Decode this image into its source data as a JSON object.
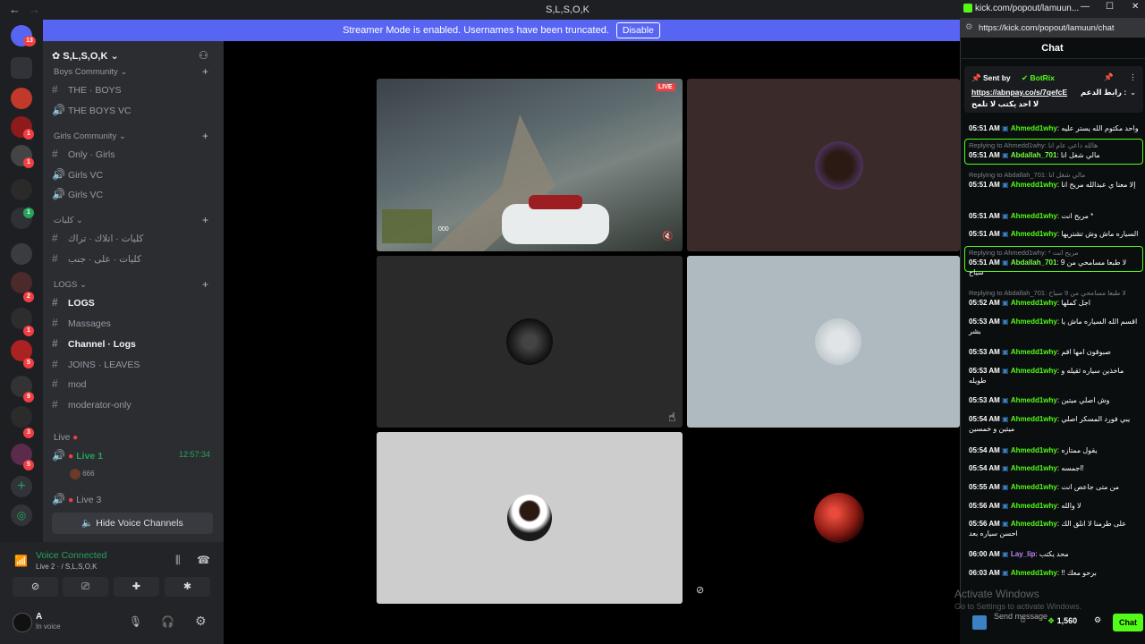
{
  "discord": {
    "window_title": "S,L,S,O,K",
    "banner": {
      "text": "Streamer Mode is enabled. Usernames have been truncated.",
      "button": "Disable"
    },
    "server_name": "S,L,S,O,K",
    "rail_badges": [
      "13",
      "1",
      "1",
      "1",
      "2",
      "1",
      "5",
      "9",
      "3",
      "5"
    ],
    "categories": [
      {
        "label": "Boys Community"
      },
      {
        "label": "Girls Community"
      },
      {
        "label": "كليات"
      },
      {
        "label": "LOGS"
      },
      {
        "label": "Live"
      }
    ],
    "channels": [
      {
        "label": "THE · BOYS"
      },
      {
        "label": "THE BOYS VC"
      },
      {
        "label": "Only · Girls"
      },
      {
        "label": "Girls VC"
      },
      {
        "label": "Girls VC"
      },
      {
        "label": "كليات · اتلاك · تراك"
      },
      {
        "label": "كليات · على · جنب"
      },
      {
        "label": "LOGS"
      },
      {
        "label": "Massages"
      },
      {
        "label": "Channel · Logs"
      },
      {
        "label": "JOINS · LEAVES"
      },
      {
        "label": "mod"
      },
      {
        "label": "moderator-only"
      }
    ],
    "live_channels": [
      {
        "label": "Live 1",
        "timer": "12:57:34"
      },
      {
        "label": "Live 3"
      }
    ],
    "live_member": "666",
    "hide_voice": "Hide Voice Channels",
    "voice": {
      "status": "Voice Connected",
      "sub": "Live 2 · / S,L,S,O,K"
    },
    "user": {
      "name": "A",
      "status": "In voice"
    },
    "live_badge": "LIVE",
    "hud_number": "000"
  },
  "kick": {
    "tab_title": "kick.com/popout/lamuun...",
    "url": "https://kick.com/popout/lamuun/chat",
    "header": "Chat",
    "pinned": {
      "label": "Sent by",
      "user": "BotRix",
      "link": "https://abnpay.co/s/7qefcE",
      "text": "رابط الدعم :",
      "text2": "لا احد يكتب لا تلمح"
    },
    "messages": [
      {
        "time": "05:51 AM",
        "user": "Ahmedd1why",
        "text": "واحد مكتوم الله يستر عليه"
      },
      {
        "reply": "Replying to Ahmedd1why: هالله داعي عام انا",
        "time": "05:51 AM",
        "user": "Abdallah_701",
        "text": "مالي شغل انا",
        "highlight": true
      },
      {
        "reply": "Replying to Abdallah_701: مالي شغل انا",
        "time": "05:51 AM",
        "user": "Ahmedd1why",
        "text": "إلا معنا ي عبدالله مريح انا"
      },
      {
        "time": "05:51 AM",
        "user": "Ahmedd1why",
        "text": "مريح انت *"
      },
      {
        "time": "05:51 AM",
        "user": "Ahmedd1why",
        "text": "السياره ماش وش تشتريها"
      },
      {
        "reply": "Replying to Ahmedd1why: * مريح انت",
        "time": "05:51 AM",
        "user": "Abdallah_701",
        "text": "لا طبعا مسامحي من 9 سياح",
        "highlight": true
      },
      {
        "reply": "Replying to Abdallah_701: لا طبعا مسامحي من 9 سياح",
        "time": "05:52 AM",
        "user": "Ahmedd1why",
        "text": "اجل كملها"
      },
      {
        "time": "05:53 AM",
        "user": "Ahmedd1why",
        "text": "اقسم الله السياره ماش يا بشر"
      },
      {
        "time": "05:53 AM",
        "user": "Ahmedd1why",
        "text": "صبوقون امها اقم"
      },
      {
        "time": "05:53 AM",
        "user": "Ahmedd1why",
        "text": "ماخذين سياره ثقيله و طويله"
      },
      {
        "time": "05:53 AM",
        "user": "Ahmedd1why",
        "text": "وش اصلي ميتين"
      },
      {
        "time": "05:54 AM",
        "user": "Ahmedd1why",
        "text": "يبي فورد المسكر اصلي ميتين و خمسين"
      },
      {
        "time": "05:54 AM",
        "user": "Ahmedd1why",
        "text": "يقول ممتازه"
      },
      {
        "time": "05:54 AM",
        "user": "Ahmedd1why",
        "text": "اجمسه!"
      },
      {
        "time": "05:55 AM",
        "user": "Ahmedd1why",
        "text": "من متى جاعص انت"
      },
      {
        "time": "05:56 AM",
        "user": "Ahmedd1why",
        "text": "لا والله"
      },
      {
        "time": "05:56 AM",
        "user": "Ahmedd1why",
        "text": "على طرمنا لا انلق الك احسن سياره بعد"
      },
      {
        "time": "06:00 AM",
        "user": "Lay_lip",
        "text": "محد يكتب"
      },
      {
        "time": "06:03 AM",
        "user": "Ahmedd1why",
        "text": "!! برحو معك"
      }
    ],
    "footer": {
      "send": "Send message",
      "points": "1,560",
      "chat": "Chat"
    },
    "watermark": {
      "title": "Activate Windows",
      "sub": "Go to Settings to activate Windows."
    }
  },
  "colors": {
    "blurple": "#5865f2",
    "kick_green": "#53fc18",
    "discord_green": "#23a55a",
    "red": "#f23f43"
  }
}
